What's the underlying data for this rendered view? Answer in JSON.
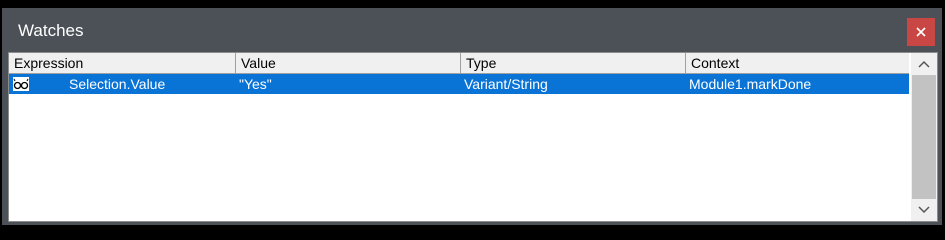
{
  "window": {
    "title": "Watches",
    "close_icon": "close-icon"
  },
  "columns": [
    "Expression",
    "Value",
    "Type",
    "Context"
  ],
  "rows": [
    {
      "icon": "watch-glasses-icon",
      "expression": "Selection.Value",
      "value": "\"Yes\"",
      "type": "Variant/String",
      "context": "Module1.markDone",
      "selected": true
    }
  ],
  "colors": {
    "titlebar": "#4b5157",
    "close_button": "#c84745",
    "selection": "#0a74d6"
  },
  "scrollbar": {
    "up_icon": "chevron-up-icon",
    "down_icon": "chevron-down-icon"
  }
}
